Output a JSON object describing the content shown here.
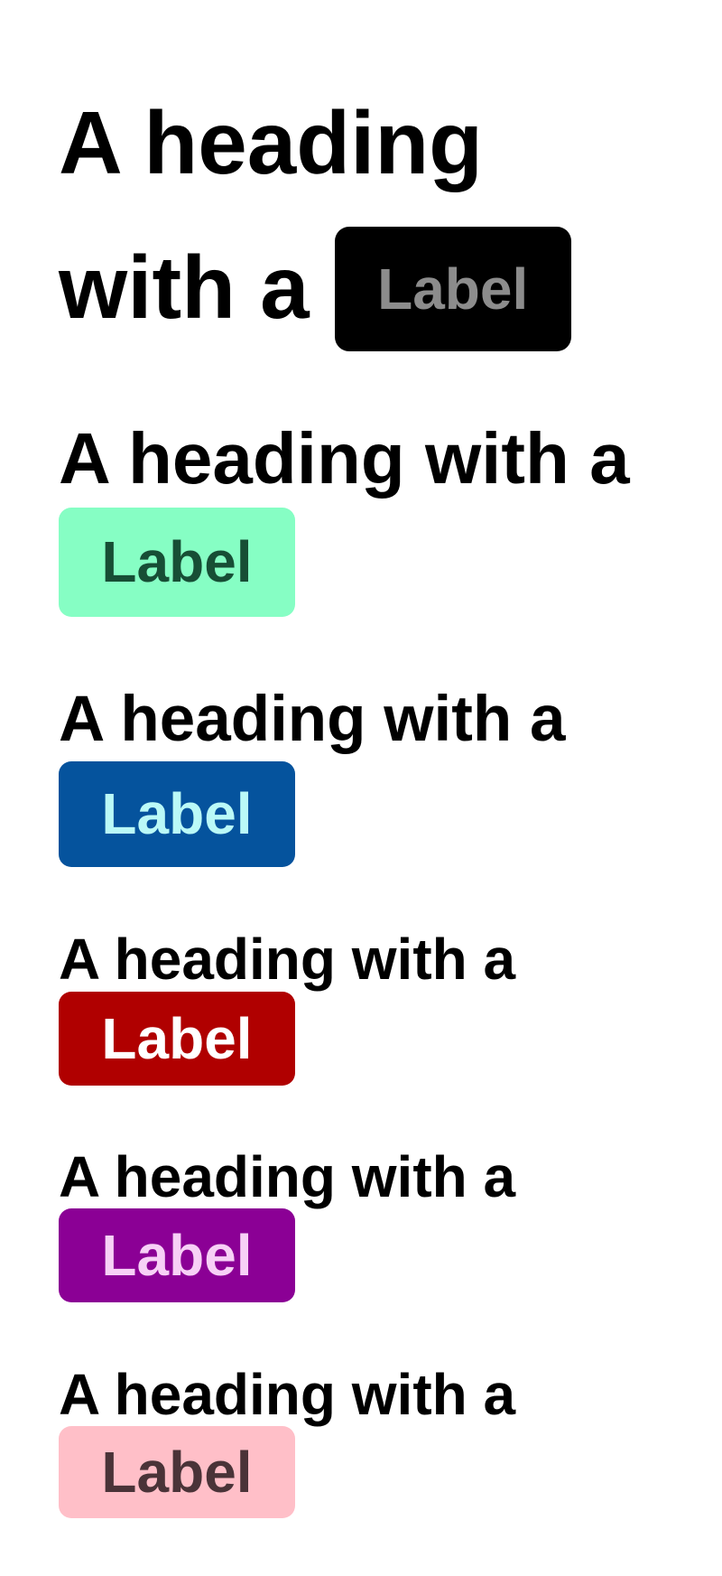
{
  "rows": [
    {
      "heading_line1": "A heading",
      "heading_line2": "with a",
      "badge_label": "Label",
      "badge_bg": "#000000",
      "badge_fg": "#8c8c8c"
    },
    {
      "heading": "A heading with a",
      "badge_label": "Label",
      "badge_bg": "#86fec4",
      "badge_fg": "#174e35"
    },
    {
      "heading": "A heading with a",
      "badge_label": "Label",
      "badge_bg": "#05539d",
      "badge_fg": "#baf9f7"
    },
    {
      "heading": "A heading with a",
      "badge_label": "Label",
      "badge_bg": "#b00000",
      "badge_fg": "#ffffff"
    },
    {
      "heading": "A heading with a",
      "badge_label": "Label",
      "badge_bg": "#8b0095",
      "badge_fg": "#f7d0f6"
    },
    {
      "heading": "A heading with a",
      "badge_label": "Label",
      "badge_bg": "#ffbfc8",
      "badge_fg": "#4a3338"
    }
  ]
}
